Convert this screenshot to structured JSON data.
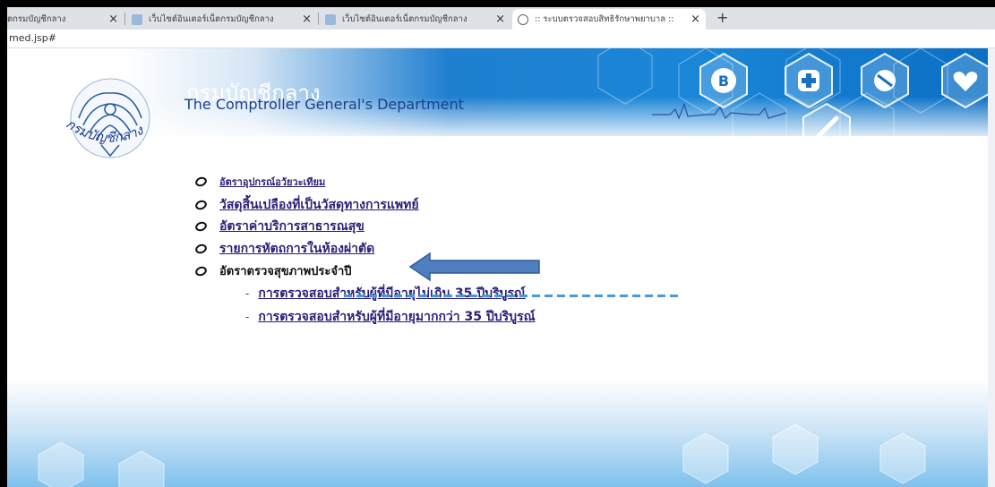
{
  "browser": {
    "tabs": [
      {
        "title": "ตกรมบัญชีกลาง",
        "active": false
      },
      {
        "title": "เว็บไซต์อินเตอร์เน็ตกรมบัญชีกลาง",
        "active": false
      },
      {
        "title": "เว็บไซต์อินเตอร์เน็ตกรมบัญชีกลาง",
        "active": false
      },
      {
        "title": ":: ระบบตรวจสอบสิทธิรักษาพยาบาล ::",
        "active": true
      }
    ],
    "close_glyph": "×",
    "new_tab_glyph": "+",
    "address": "med.jsp#"
  },
  "header": {
    "title_th": "กรมบัญชีกลาง",
    "title_en": "The Comptroller General's Department",
    "logo_text": "กรมบัญชีกลาง",
    "icons": [
      "bitcoin-icon",
      "plus-icon",
      "pill-icon",
      "heart-pulse-icon",
      "syringe-icon"
    ],
    "colors": {
      "banner": "#1a86d8",
      "title_en": "#1b3f8a",
      "link": "#2a1f77",
      "arrow": "#4f7fc0"
    }
  },
  "menu": {
    "items": [
      {
        "label": "อัตราอุปกรณ์อวัยวะเทียม",
        "link": true
      },
      {
        "label": "วัสดุสิ้นเปลืองที่เป็นวัสดุทางการแพทย์",
        "link": true
      },
      {
        "label": "อัตราค่าบริการสาธารณสุข",
        "link": true
      },
      {
        "label": "รายการหัตถการในห้องผ่าตัด",
        "link": true
      },
      {
        "label": "อัตราตรวจสุขภาพประจำปี",
        "link": false
      }
    ],
    "subitems": [
      {
        "label": "การตรวจสอบสำหรับผู้ที่มีอายุไม่เกิน 35 ปีบริบูรณ์"
      },
      {
        "label": "การตรวจสอบสำหรับผู้ที่มีอายุมากกว่า 35 ปีบริบูรณ์"
      }
    ],
    "sub_bullet": "-"
  }
}
